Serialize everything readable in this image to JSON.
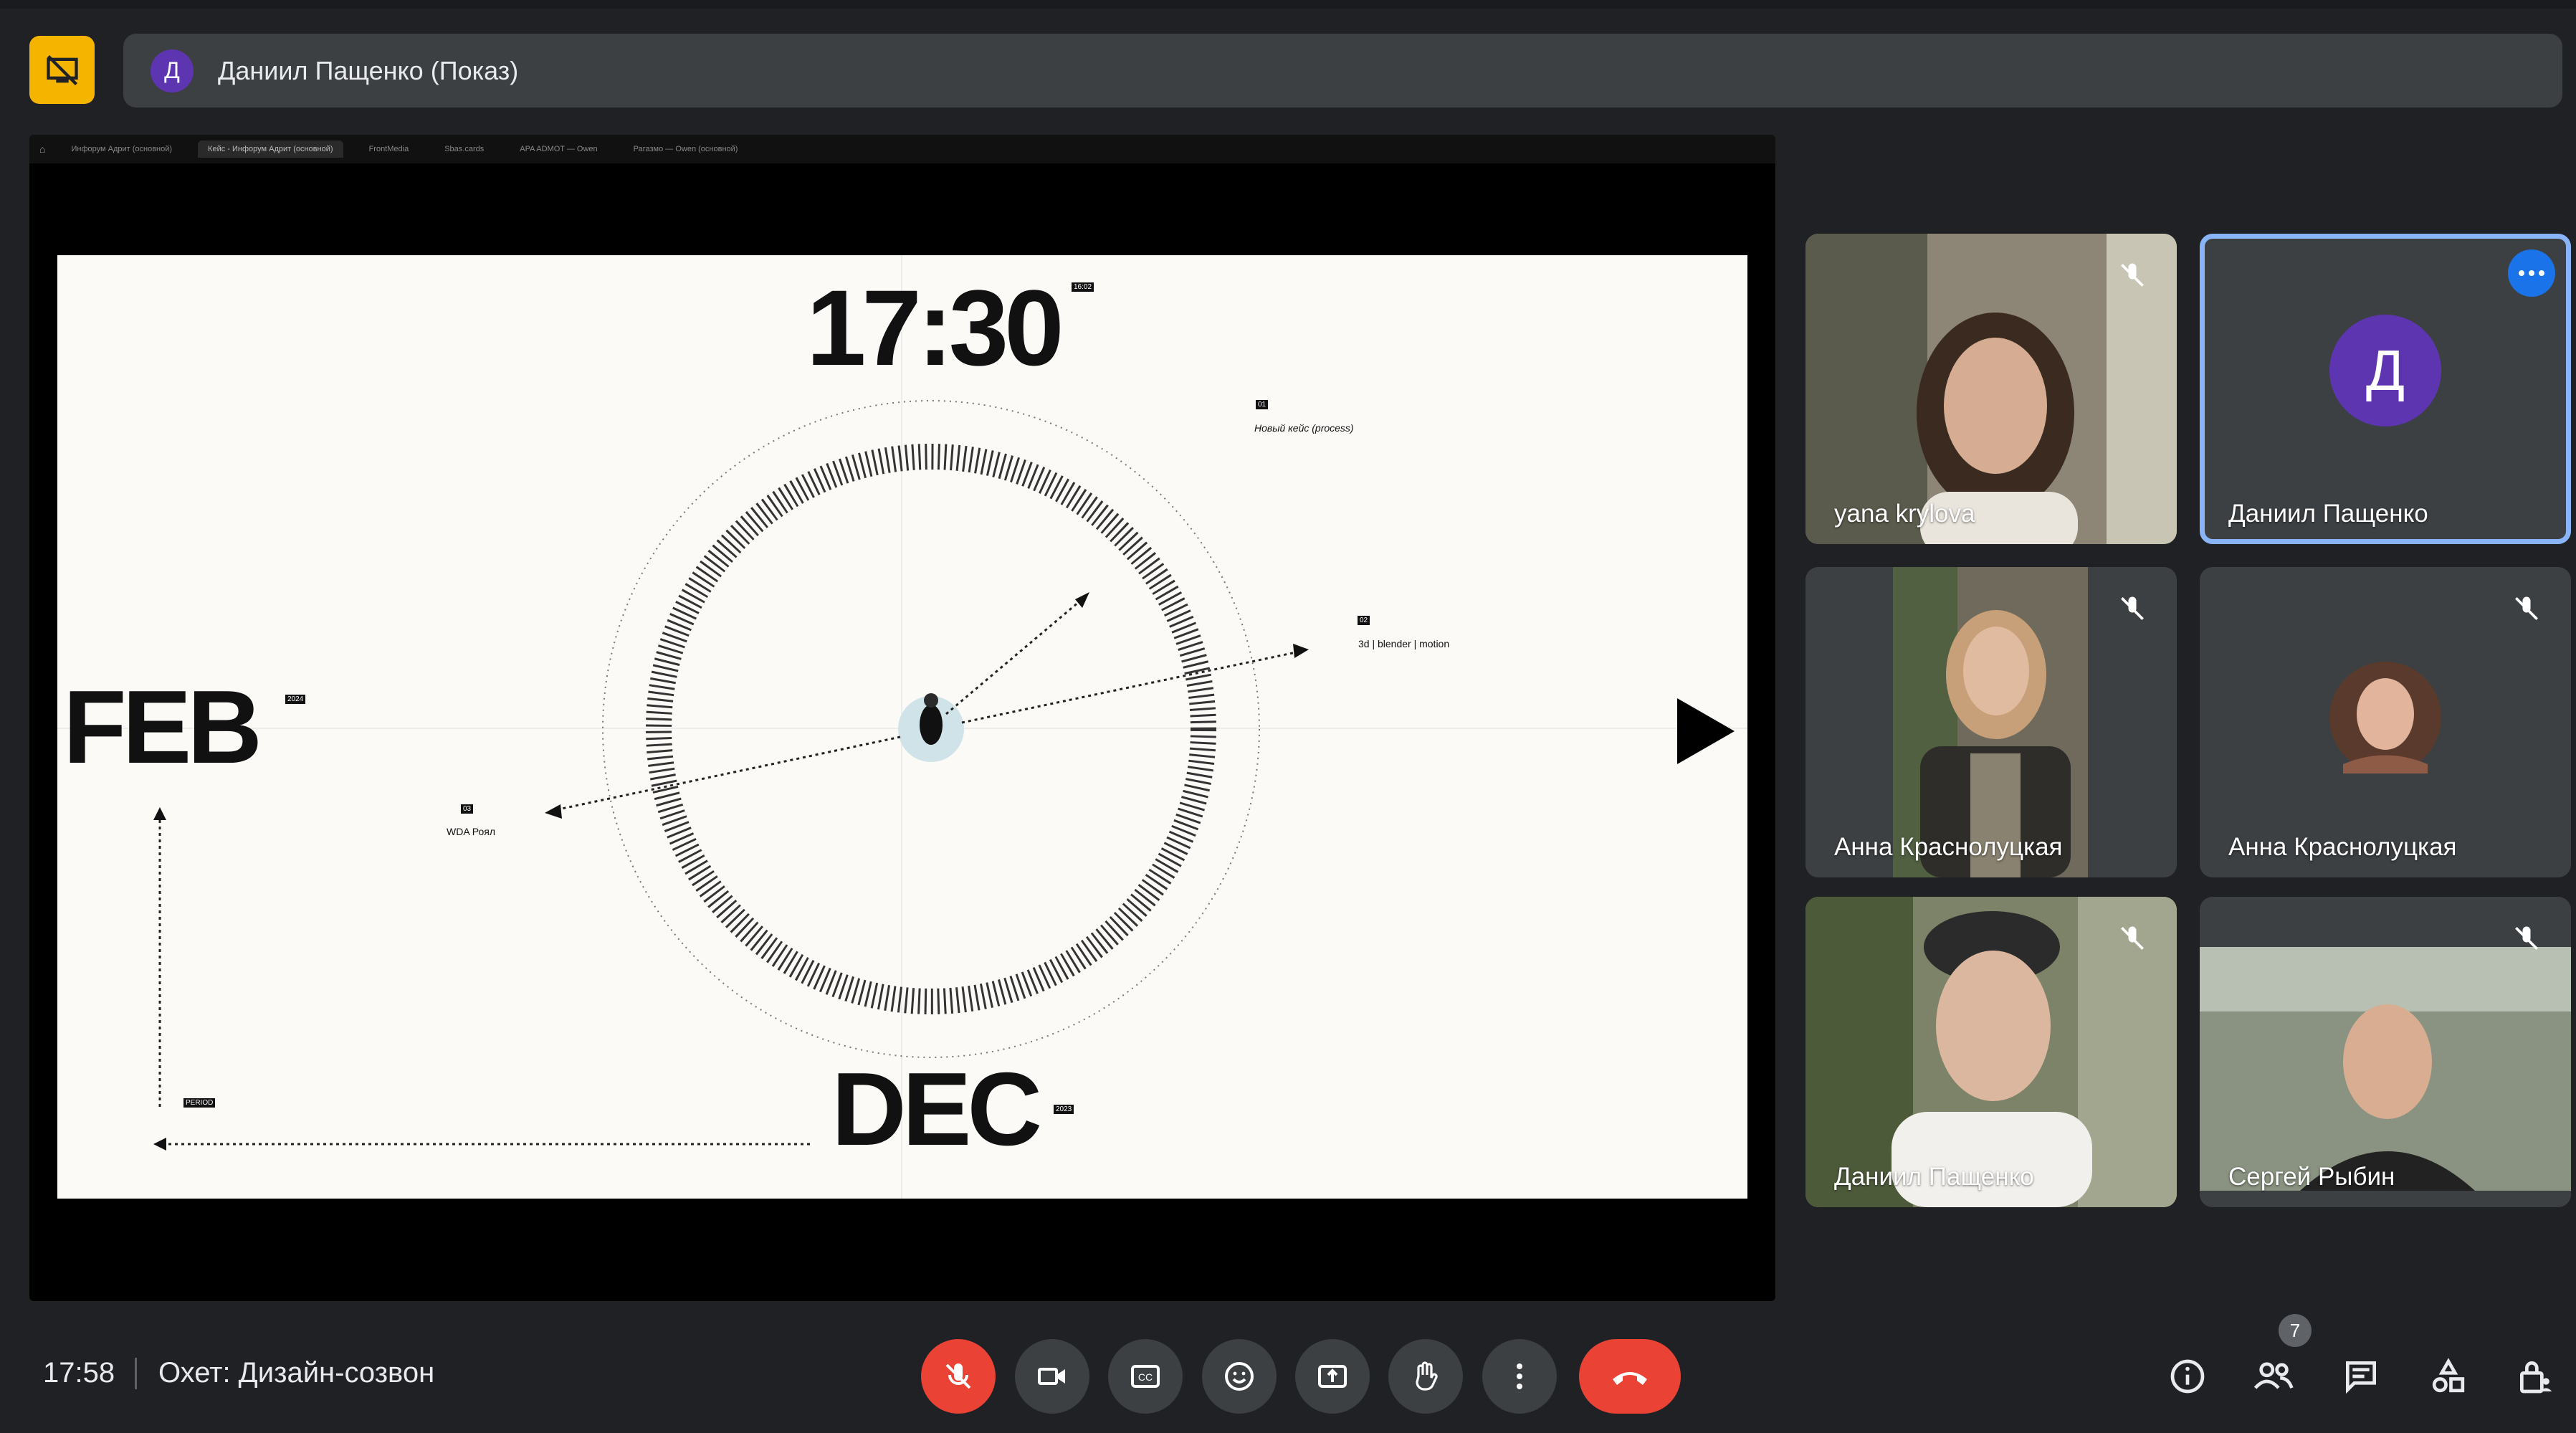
{
  "header": {
    "presenter_initial": "Д",
    "presenter_label": "Даниил Пащенко (Показ)"
  },
  "shared_screen": {
    "tabs": [
      "Инфорум Адрит (основной)",
      "Кейс - Инфорум Адрит (основной)",
      "FrontMedia",
      "Sbas.cards",
      "APA ADMOT — Owen",
      "Рагазмо — Owen (основной)"
    ],
    "slide": {
      "time": "17:30",
      "time_tag": "16:02",
      "feb": "FEB",
      "feb_tag": "2024",
      "dec": "DEC",
      "dec_tag": "2023",
      "note_new_case": "Новый кейс (process)",
      "note_3d": "3d | blender | motion",
      "note_wda": "WDA Роял",
      "period_tag": "PERIOD"
    }
  },
  "participants": [
    {
      "name": "yana krylova",
      "muted": true,
      "type": "video",
      "bg": "#a9a08f"
    },
    {
      "name": "Даниил Пащенко",
      "initial": "Д",
      "muted": false,
      "type": "avatar",
      "active": true
    },
    {
      "name": "Анна Краснолуцкая",
      "muted": true,
      "type": "video",
      "bg": "#6f6a5c"
    },
    {
      "name": "Анна Краснолуцкая",
      "muted": true,
      "type": "photo"
    },
    {
      "name": "Даниил Пащенко",
      "muted": true,
      "type": "video",
      "bg": "#7c8369"
    },
    {
      "name": "Сергей Рыбин",
      "muted": true,
      "type": "video",
      "bg": "#8a9381"
    }
  ],
  "bottom_bar": {
    "time": "17:58",
    "meeting_title": "Охет: Дизайн-созвон",
    "people_count": "7"
  },
  "colors": {
    "background": "#202124",
    "control": "#3c4043",
    "danger": "#ea4335",
    "accent": "#8ab4f8",
    "avatar": "#5e35b1"
  }
}
